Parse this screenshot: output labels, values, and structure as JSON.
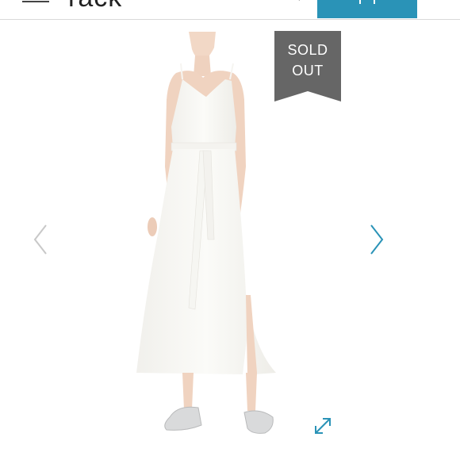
{
  "header": {
    "logo_text": "rack",
    "menu_icon": "hamburger-icon",
    "search_icon": "search-icon",
    "bag_icon": "shopping-bag-icon",
    "accent_color": "#2a93b7"
  },
  "product": {
    "badge_line1": "SOLD",
    "badge_line2": "OUT",
    "badge_color": "#666666",
    "image": "white-satin-slip-dress"
  },
  "gallery": {
    "prev_icon": "chevron-left-icon",
    "next_icon": "chevron-right-icon",
    "expand_icon": "expand-icon",
    "prev_color": "#c8c8c8",
    "next_color": "#2a93b7"
  }
}
